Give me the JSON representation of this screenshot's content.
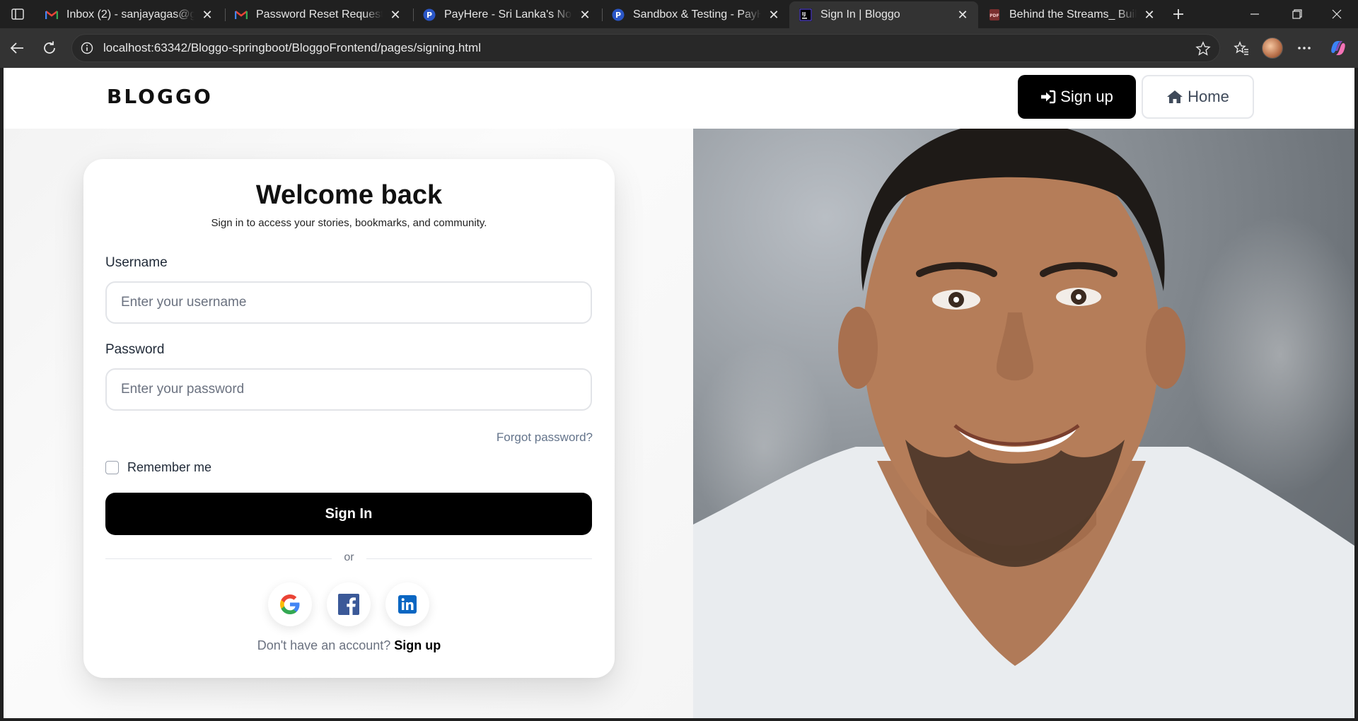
{
  "browser": {
    "tabs": [
      {
        "title": "Inbox (2) - sanjayagas@gma",
        "favicon": "gmail-icon"
      },
      {
        "title": "Password Reset Request - sa",
        "favicon": "gmail-icon"
      },
      {
        "title": "PayHere - Sri Lanka's No.1 O",
        "favicon": "payhere-icon"
      },
      {
        "title": "Sandbox & Testing - PayHer",
        "favicon": "payhere-icon"
      },
      {
        "title": "Sign In | Bloggo",
        "favicon": "intellij-icon",
        "active": true
      },
      {
        "title": "Behind the Streams_ Building",
        "favicon": "pdf-icon"
      }
    ],
    "url": "localhost:63342/Bloggo-springboot/BloggoFrontend/pages/signing.html"
  },
  "header": {
    "logo": "BLOGGO",
    "signup_label": "Sign up",
    "home_label": "Home"
  },
  "login": {
    "title": "Welcome back",
    "subtitle": "Sign in to access your stories, bookmarks, and community.",
    "username_label": "Username",
    "username_placeholder": "Enter your username",
    "password_label": "Password",
    "password_placeholder": "Enter your password",
    "forgot": "Forgot password?",
    "remember": "Remember me",
    "submit": "Sign In",
    "or": "or",
    "no_account": "Don't have an account?",
    "signup_link": "Sign up"
  },
  "colors": {
    "accent": "#000000",
    "muted": "#64748b"
  }
}
